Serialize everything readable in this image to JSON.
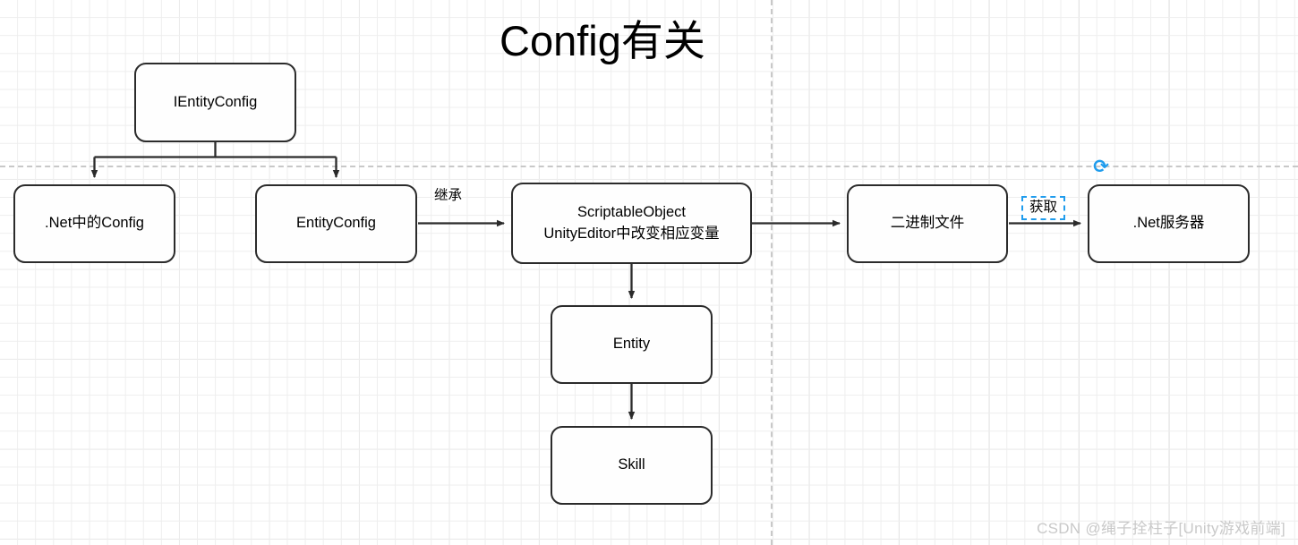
{
  "diagram": {
    "title": "Config有关",
    "watermark": "CSDN @绳子拴柱子[Unity游戏前端]",
    "theme": {
      "node_border": "#2b2b2b",
      "node_fill": "#fefefe",
      "edge_color": "#2b2b2b",
      "grid_minor": "#eeeeee",
      "grid_major": "#d6d6d6",
      "guide_color": "#c8c8c8",
      "selection_blue": "#1f9ced",
      "watermark_color": "#c9c9c9"
    },
    "nodes": [
      {
        "id": "ientityconfig",
        "label": "IEntityConfig"
      },
      {
        "id": "net_config",
        "label": ".Net中的Config"
      },
      {
        "id": "entityconfig",
        "label": "EntityConfig"
      },
      {
        "id": "scriptableobject",
        "label": "ScriptableObject\nUnityEditor中改变相应变量"
      },
      {
        "id": "binary_file",
        "label": "二进制文件"
      },
      {
        "id": "net_server",
        "label": ".Net服务器"
      },
      {
        "id": "entity",
        "label": "Entity"
      },
      {
        "id": "skill",
        "label": "Skill"
      }
    ],
    "edge_labels": [
      {
        "id": "inherit",
        "label": "继承",
        "selected": false
      },
      {
        "id": "fetch",
        "label": "获取",
        "selected": true
      }
    ],
    "icons": [
      {
        "id": "rotate-handle",
        "name": "rotate-icon",
        "glyph": "⟳",
        "color": "#1f9ced"
      }
    ]
  }
}
